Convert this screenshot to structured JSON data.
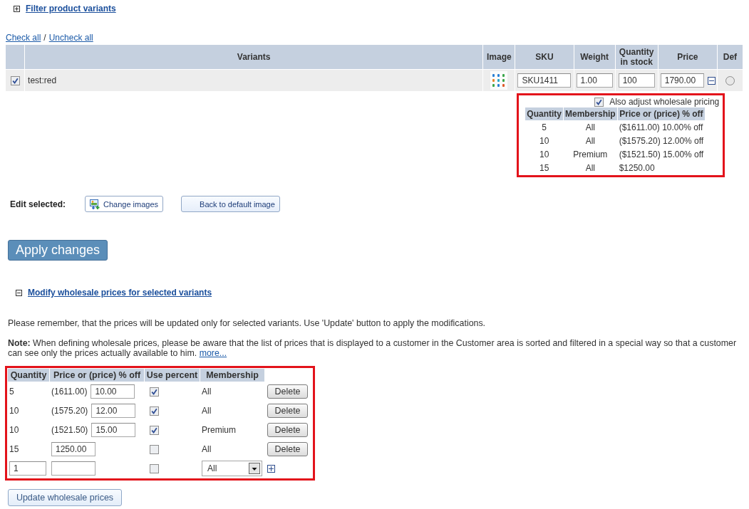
{
  "filter_section": {
    "label": "Filter product variants",
    "expanded": false
  },
  "select_links": {
    "check_all": "Check all",
    "separator": "/",
    "uncheck_all": "Uncheck all"
  },
  "variants_table": {
    "columns": [
      "Variants",
      "Image",
      "SKU",
      "Weight",
      "Quantity in stock",
      "Price",
      "Def"
    ],
    "rows": [
      {
        "checked": true,
        "name": "test:red",
        "sku": "SKU1411",
        "weight": "1.00",
        "quantity": "100",
        "price": "1790.00",
        "wholesale_expanded": true,
        "default": false,
        "wholesale": {
          "highlighted": true,
          "adjust_checked": true,
          "adjust_label": "Also adjust wholesale pricing",
          "columns": [
            "Quantity",
            "Membership",
            "Price or (price) % off"
          ],
          "rows": [
            {
              "quantity": "5",
              "membership": "All",
              "price": "($1611.00) 10.00% off"
            },
            {
              "quantity": "10",
              "membership": "All",
              "price": "($1575.20) 12.00% off"
            },
            {
              "quantity": "10",
              "membership": "Premium",
              "price": "($1521.50) 15.00% off"
            },
            {
              "quantity": "15",
              "membership": "All",
              "price": "$1250.00"
            }
          ]
        }
      }
    ]
  },
  "edit_selected": {
    "label": "Edit selected:",
    "buttons": [
      {
        "kind": "with_icon",
        "label": "Change images"
      },
      {
        "kind": "plain",
        "label": "Back to default image"
      }
    ]
  },
  "apply_button": "Apply changes",
  "wholesale_section": {
    "label": "Modify wholesale prices for selected variants",
    "expanded": true,
    "intro": "Please remember, that the prices will be updated only for selected variants. Use 'Update' button to apply the modifications.",
    "note": "**Note:** When defining wholesale prices, please be aware that the list of prices that is displayed to a customer in the Customer area is sorted and filtered in a special way so that a customer can see only the prices actually available to him.",
    "more_link": "more...",
    "table": {
      "highlighted": true,
      "columns": [
        "Quantity",
        "Price or (price) % off",
        "Use percent",
        "Membership"
      ],
      "rows": [
        {
          "kind": "existing",
          "quantity": "5",
          "base_price": "(1611.00)",
          "percent": "10.00",
          "use_percent": true,
          "membership": "All",
          "delete_label": "Delete"
        },
        {
          "kind": "existing",
          "quantity": "10",
          "base_price": "(1575.20)",
          "percent": "12.00",
          "use_percent": true,
          "membership": "All",
          "delete_label": "Delete"
        },
        {
          "kind": "existing",
          "quantity": "10",
          "base_price": "(1521.50)",
          "percent": "15.00",
          "use_percent": true,
          "membership": "Premium",
          "delete_label": "Delete"
        },
        {
          "kind": "existing",
          "quantity": "15",
          "price": "1250.00",
          "use_percent": false,
          "membership": "All",
          "delete_label": "Delete"
        },
        {
          "kind": "new",
          "quantity": "1",
          "use_percent": false,
          "membership": "All"
        }
      ]
    },
    "update_button": "Update wholesale prices"
  }
}
